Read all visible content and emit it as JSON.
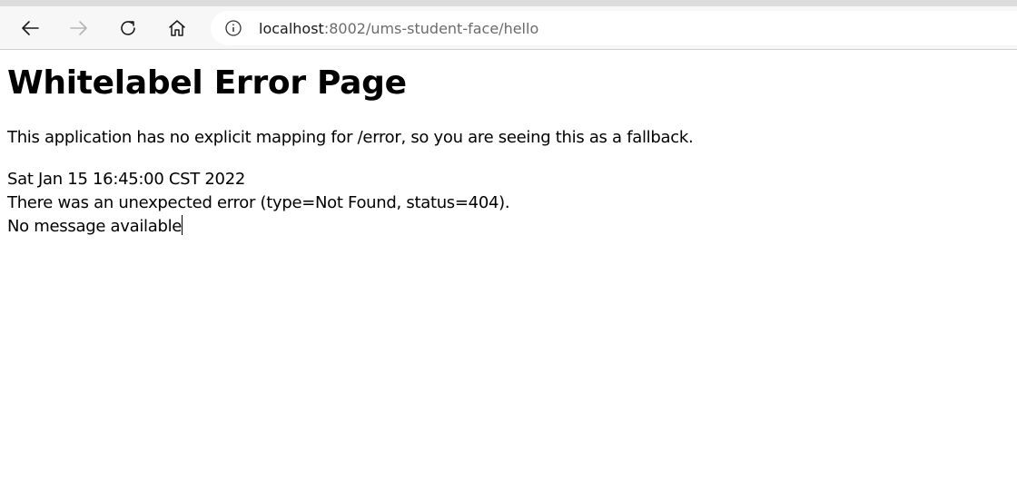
{
  "browser": {
    "url_host": "localhost",
    "url_rest": ":8002/ums-student-face/hello",
    "icons": {
      "back": "back-arrow-icon",
      "forward": "forward-arrow-icon",
      "reload": "reload-icon",
      "home": "home-icon",
      "info": "info-icon"
    }
  },
  "page": {
    "title": "Whitelabel Error Page",
    "fallback_text": "This application has no explicit mapping for /error, so you are seeing this as a fallback.",
    "timestamp": "Sat Jan 15 16:45:00 CST 2022",
    "error_text": "There was an unexpected error (type=Not Found, status=404).",
    "message": "No message available"
  }
}
